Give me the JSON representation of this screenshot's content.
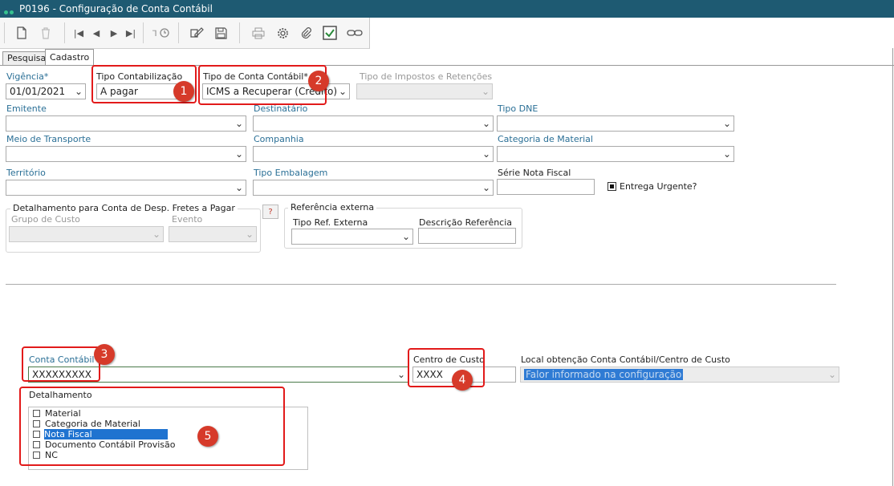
{
  "window": {
    "title": "P0196 - Configuração de Conta Contábil"
  },
  "toolbar": {
    "icons": [
      "new-document-icon",
      "delete-icon",
      "first-record-icon",
      "previous-record-icon",
      "next-record-icon",
      "last-record-icon",
      "search-history-icon",
      "edit-icon",
      "save-icon",
      "print-icon",
      "settings-icon",
      "attachment-icon",
      "check-icon",
      "link-icon"
    ]
  },
  "tabs": {
    "search": "Pesquisa",
    "register": "Cadastro"
  },
  "form": {
    "vigencia": {
      "label": "Vigência*",
      "value": "01/01/2021"
    },
    "tipo_contabilizacao": {
      "label": "Tipo Contabilização",
      "value": "A pagar"
    },
    "tipo_conta": {
      "label": "Tipo de Conta Contábil*",
      "value": "ICMS a Recuperar (Credito)"
    },
    "tipo_impostos": {
      "label": "Tipo de Impostos e Retenções",
      "value": ""
    },
    "emitente": {
      "label": "Emitente",
      "value": ""
    },
    "destinatario": {
      "label": "Destinatário",
      "value": ""
    },
    "tipo_dne": {
      "label": "Tipo DNE",
      "value": ""
    },
    "meio_transporte": {
      "label": "Meio de Transporte",
      "value": ""
    },
    "companhia": {
      "label": "Companhia",
      "value": ""
    },
    "categoria_material": {
      "label": "Categoria de Material",
      "value": ""
    },
    "territorio": {
      "label": "Território",
      "value": ""
    },
    "tipo_embalagem": {
      "label": "Tipo Embalagem",
      "value": ""
    },
    "serie_nf": {
      "label": "Série Nota Fiscal",
      "value": ""
    },
    "entrega_urgente": {
      "label": "Entrega Urgente?",
      "checked": true
    },
    "detalhamento_frete": {
      "title": "Detalhamento para Conta de Desp. Fretes a Pagar",
      "grupo_custo": "Grupo de Custo",
      "evento": "Evento",
      "help": "?"
    },
    "ref_externa": {
      "title": "Referência externa",
      "tipo": "Tipo Ref. Externa",
      "descricao": "Descrição Referência"
    },
    "conta_contabil": {
      "label": "Conta Contábil",
      "value": "XXXXXXXXX"
    },
    "centro_custo": {
      "label": "Centro de Custo",
      "value": "XXXX"
    },
    "local_obtencao": {
      "label": "Local obtenção Conta Contábil/Centro de Custo",
      "value": "Falor informado na configuração"
    },
    "detalhamento": {
      "label": "Detalhamento",
      "items": [
        "Material",
        "Categoria de Material",
        "Nota Fiscal",
        "Documento Contábil Provisão",
        "NC"
      ],
      "selected": "Nota Fiscal"
    }
  },
  "annotations": [
    "1",
    "2",
    "3",
    "4",
    "5"
  ],
  "colors": {
    "titlebar": "#1e5a72",
    "highlight": "#e21a1a",
    "badge": "#d63a2a",
    "selection": "#1f73d0"
  }
}
